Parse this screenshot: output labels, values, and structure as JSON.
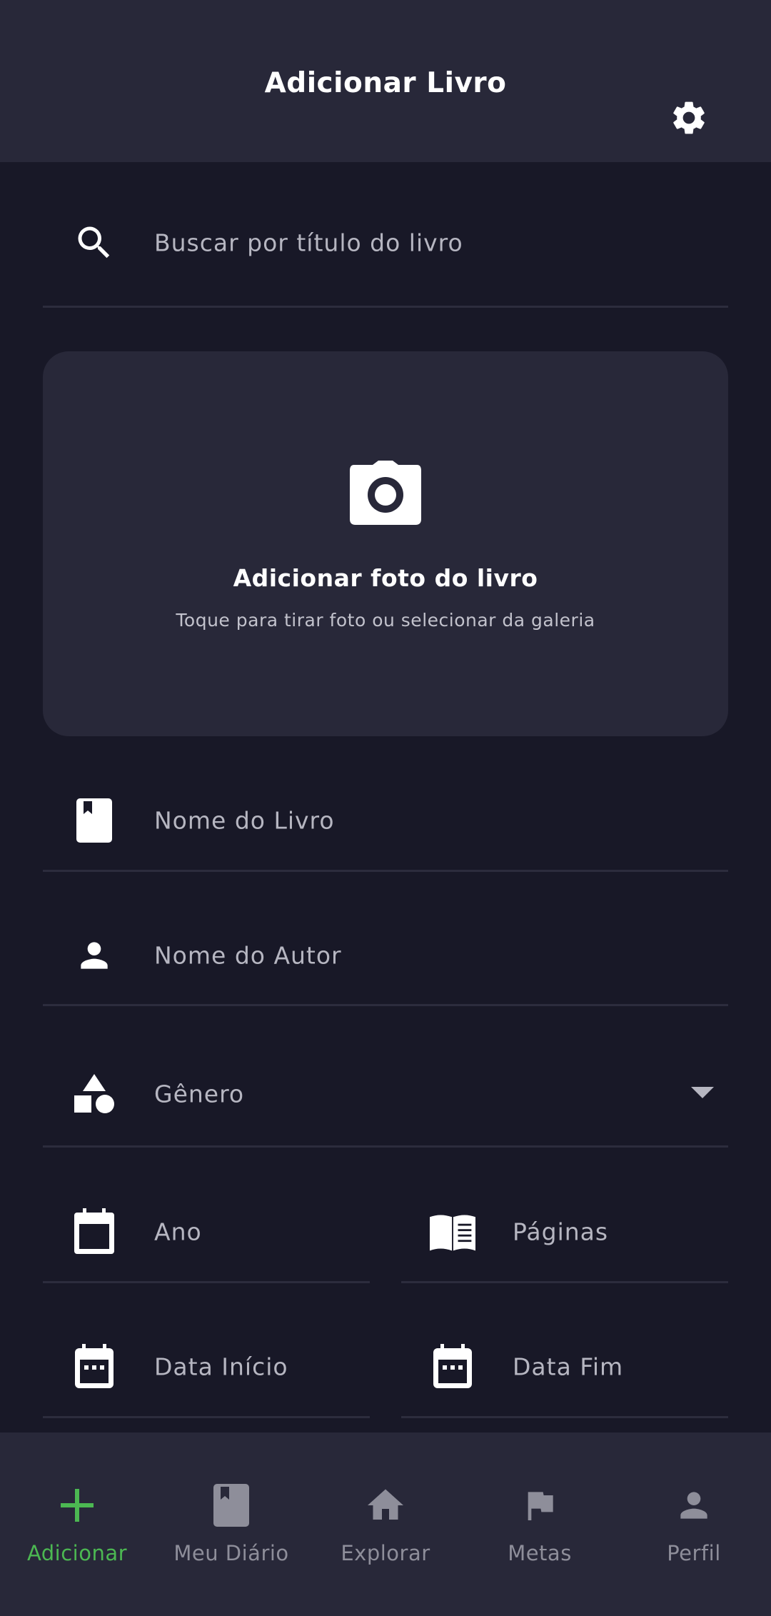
{
  "header": {
    "title": "Adicionar Livro"
  },
  "search": {
    "placeholder": "Buscar por título do livro"
  },
  "photo": {
    "title": "Adicionar foto do livro",
    "subtitle": "Toque para tirar foto ou selecionar da galeria"
  },
  "form": {
    "book_name": "Nome do Livro",
    "author_name": "Nome do Autor",
    "genre": "Gênero",
    "year": "Ano",
    "pages": "Páginas",
    "start_date": "Data Início",
    "end_date": "Data Fim"
  },
  "nav": {
    "items": [
      {
        "label": "Adicionar",
        "icon": "plus-icon",
        "active": true
      },
      {
        "label": "Meu Diário",
        "icon": "bookmark-book-icon",
        "active": false
      },
      {
        "label": "Explorar",
        "icon": "home-icon",
        "active": false
      },
      {
        "label": "Metas",
        "icon": "flag-icon",
        "active": false
      },
      {
        "label": "Perfil",
        "icon": "person-icon",
        "active": false
      }
    ]
  },
  "colors": {
    "background": "#181827",
    "surface": "#282839",
    "accent": "#4cb852",
    "muted": "#8e8e9a"
  }
}
